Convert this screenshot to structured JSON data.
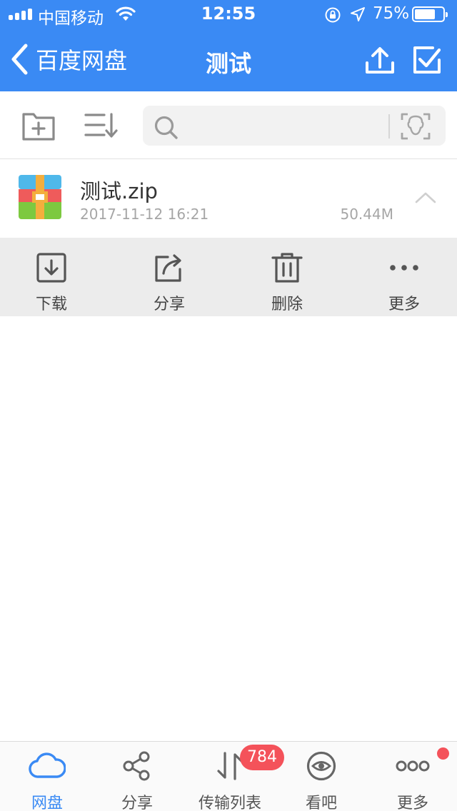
{
  "status": {
    "carrier": "中国移动",
    "time": "12:55",
    "battery_percent": "75%",
    "battery_level": 0.75
  },
  "nav": {
    "back_label": "百度网盘",
    "title": "测试",
    "icons": [
      "chevron-left-icon",
      "upload-icon",
      "checkbox-icon"
    ]
  },
  "toolbar": {
    "icons": [
      "folder-plus-icon",
      "sort-icon",
      "search-icon",
      "face-scan-icon"
    ],
    "search_value": "",
    "search_placeholder": ""
  },
  "file": {
    "name": "测试.zip",
    "date": "2017-11-12 16:21",
    "size": "50.44M",
    "icon": "zip-file-icon"
  },
  "actions": [
    {
      "label": "下载",
      "icon": "download-icon"
    },
    {
      "label": "分享",
      "icon": "share-icon"
    },
    {
      "label": "删除",
      "icon": "trash-icon"
    },
    {
      "label": "更多",
      "icon": "more-dots-icon"
    }
  ],
  "tabs": [
    {
      "label": "网盘",
      "icon": "cloud-icon",
      "active": true
    },
    {
      "label": "分享",
      "icon": "share-nodes-icon"
    },
    {
      "label": "传输列表",
      "icon": "transfer-icon",
      "badge": "784"
    },
    {
      "label": "看吧",
      "icon": "eye-icon"
    },
    {
      "label": "更多",
      "icon": "more-circles-icon",
      "dot": true
    }
  ],
  "colors": {
    "brand_blue": "#3a8af4",
    "badge_red": "#f4525a",
    "action_bg": "#ececec"
  }
}
